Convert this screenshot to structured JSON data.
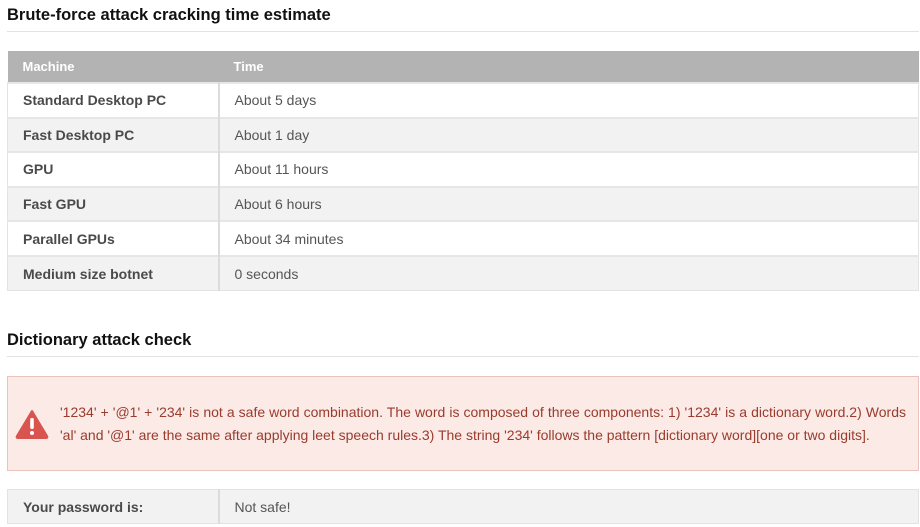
{
  "bruteforce": {
    "title": "Brute-force attack cracking time estimate",
    "headers": {
      "machine": "Machine",
      "time": "Time"
    },
    "rows": [
      {
        "machine": "Standard Desktop PC",
        "time": "About 5 days"
      },
      {
        "machine": "Fast Desktop PC",
        "time": "About 1 day"
      },
      {
        "machine": "GPU",
        "time": "About 11 hours"
      },
      {
        "machine": "Fast GPU",
        "time": "About 6 hours"
      },
      {
        "machine": "Parallel GPUs",
        "time": "About 34 minutes"
      },
      {
        "machine": "Medium size botnet",
        "time": "0 seconds"
      }
    ]
  },
  "dictionary": {
    "title": "Dictionary attack check",
    "alert": {
      "icon": "warning-triangle-icon",
      "color": "#d9534f",
      "text": "'1234' + '@1' + '234' is not a safe word combination. The word is composed of three components: 1) '1234' is a dictionary word.2) Words 'al' and '@1' are the same after applying leet speech rules.3) The string '234' follows the pattern [dictionary word][one or two digits]."
    }
  },
  "result": {
    "label": "Your password is:",
    "value": "Not safe!"
  }
}
